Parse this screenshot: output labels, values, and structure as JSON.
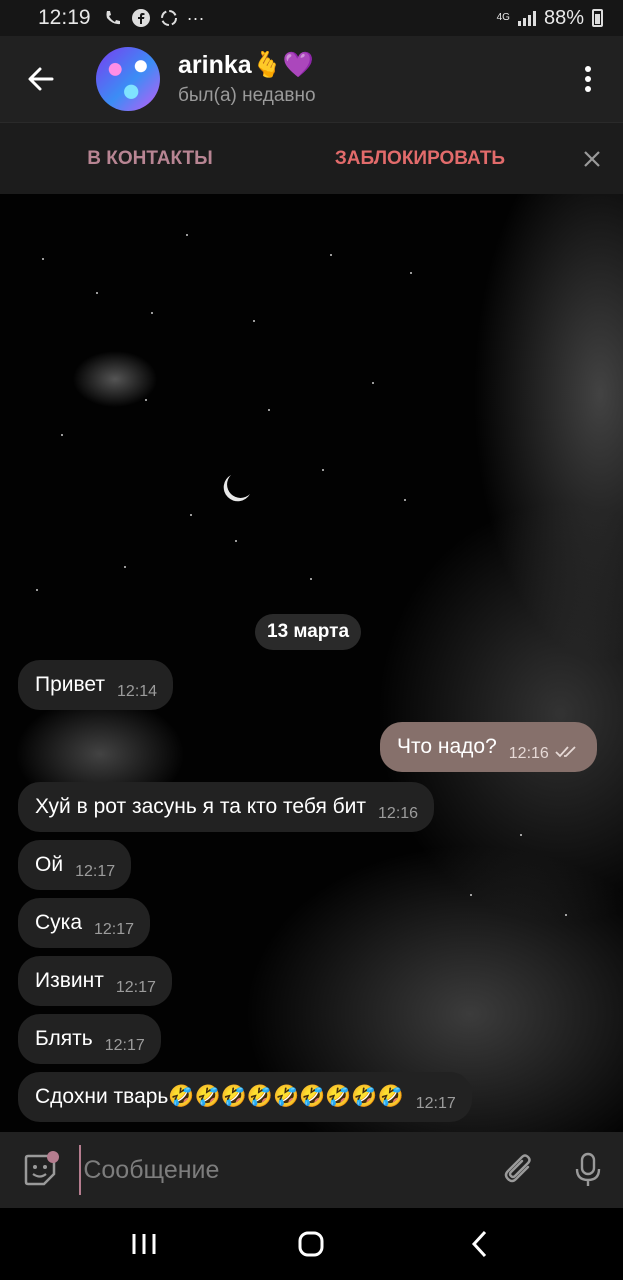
{
  "status_bar": {
    "time": "12:19",
    "network": "4G",
    "battery": "88%"
  },
  "header": {
    "name": "arinka🫰💜",
    "status": "был(а) недавно"
  },
  "action_bar": {
    "add_contact": "В КОНТАКТЫ",
    "block": "ЗАБЛОКИРОВАТЬ"
  },
  "chat": {
    "date": "13 марта",
    "messages": [
      {
        "direction": "in",
        "text": "Привет",
        "time": "12:14"
      },
      {
        "direction": "out",
        "text": "Что надо?",
        "time": "12:16",
        "read": true
      },
      {
        "direction": "in",
        "text": "Хуй в рот засунь я та кто тебя бит",
        "time": "12:16"
      },
      {
        "direction": "in",
        "text": "Ой",
        "time": "12:17"
      },
      {
        "direction": "in",
        "text": "Сука",
        "time": "12:17"
      },
      {
        "direction": "in",
        "text": "Извинт",
        "time": "12:17"
      },
      {
        "direction": "in",
        "text": "Блять",
        "time": "12:17"
      },
      {
        "direction": "in",
        "text": "Сдохни тварь🤣🤣🤣🤣🤣🤣🤣🤣🤣",
        "time": "12:17"
      }
    ]
  },
  "input": {
    "placeholder": "Сообщение"
  },
  "colors": {
    "accent": "#b57d8f",
    "outgoing_bubble": "#86706b",
    "incoming_bubble": "#222222",
    "block_red": "#e26b6b"
  },
  "icons": [
    "back-arrow-icon",
    "more-vert-icon",
    "close-icon",
    "sticker-icon",
    "paperclip-icon",
    "microphone-icon",
    "recents-icon",
    "home-icon",
    "nav-back-icon"
  ]
}
